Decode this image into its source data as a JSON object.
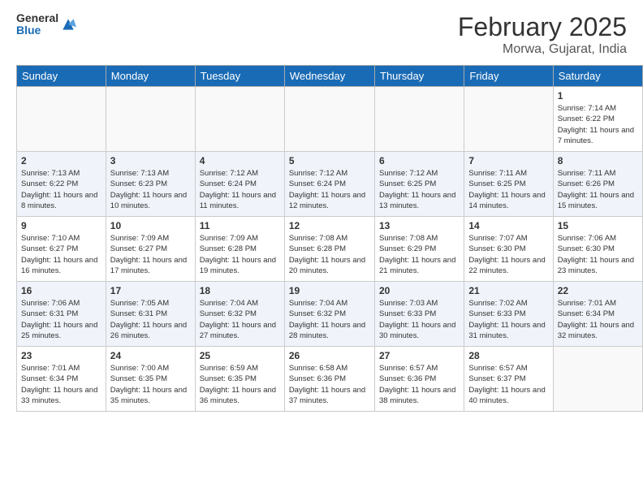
{
  "header": {
    "logo_general": "General",
    "logo_blue": "Blue",
    "month_title": "February 2025",
    "location": "Morwa, Gujarat, India"
  },
  "days_of_week": [
    "Sunday",
    "Monday",
    "Tuesday",
    "Wednesday",
    "Thursday",
    "Friday",
    "Saturday"
  ],
  "weeks": [
    {
      "days": [
        {
          "num": "",
          "info": ""
        },
        {
          "num": "",
          "info": ""
        },
        {
          "num": "",
          "info": ""
        },
        {
          "num": "",
          "info": ""
        },
        {
          "num": "",
          "info": ""
        },
        {
          "num": "",
          "info": ""
        },
        {
          "num": "1",
          "info": "Sunrise: 7:14 AM\nSunset: 6:22 PM\nDaylight: 11 hours and 7 minutes."
        }
      ]
    },
    {
      "days": [
        {
          "num": "2",
          "info": "Sunrise: 7:13 AM\nSunset: 6:22 PM\nDaylight: 11 hours and 8 minutes."
        },
        {
          "num": "3",
          "info": "Sunrise: 7:13 AM\nSunset: 6:23 PM\nDaylight: 11 hours and 10 minutes."
        },
        {
          "num": "4",
          "info": "Sunrise: 7:12 AM\nSunset: 6:24 PM\nDaylight: 11 hours and 11 minutes."
        },
        {
          "num": "5",
          "info": "Sunrise: 7:12 AM\nSunset: 6:24 PM\nDaylight: 11 hours and 12 minutes."
        },
        {
          "num": "6",
          "info": "Sunrise: 7:12 AM\nSunset: 6:25 PM\nDaylight: 11 hours and 13 minutes."
        },
        {
          "num": "7",
          "info": "Sunrise: 7:11 AM\nSunset: 6:25 PM\nDaylight: 11 hours and 14 minutes."
        },
        {
          "num": "8",
          "info": "Sunrise: 7:11 AM\nSunset: 6:26 PM\nDaylight: 11 hours and 15 minutes."
        }
      ]
    },
    {
      "days": [
        {
          "num": "9",
          "info": "Sunrise: 7:10 AM\nSunset: 6:27 PM\nDaylight: 11 hours and 16 minutes."
        },
        {
          "num": "10",
          "info": "Sunrise: 7:09 AM\nSunset: 6:27 PM\nDaylight: 11 hours and 17 minutes."
        },
        {
          "num": "11",
          "info": "Sunrise: 7:09 AM\nSunset: 6:28 PM\nDaylight: 11 hours and 19 minutes."
        },
        {
          "num": "12",
          "info": "Sunrise: 7:08 AM\nSunset: 6:28 PM\nDaylight: 11 hours and 20 minutes."
        },
        {
          "num": "13",
          "info": "Sunrise: 7:08 AM\nSunset: 6:29 PM\nDaylight: 11 hours and 21 minutes."
        },
        {
          "num": "14",
          "info": "Sunrise: 7:07 AM\nSunset: 6:30 PM\nDaylight: 11 hours and 22 minutes."
        },
        {
          "num": "15",
          "info": "Sunrise: 7:06 AM\nSunset: 6:30 PM\nDaylight: 11 hours and 23 minutes."
        }
      ]
    },
    {
      "days": [
        {
          "num": "16",
          "info": "Sunrise: 7:06 AM\nSunset: 6:31 PM\nDaylight: 11 hours and 25 minutes."
        },
        {
          "num": "17",
          "info": "Sunrise: 7:05 AM\nSunset: 6:31 PM\nDaylight: 11 hours and 26 minutes."
        },
        {
          "num": "18",
          "info": "Sunrise: 7:04 AM\nSunset: 6:32 PM\nDaylight: 11 hours and 27 minutes."
        },
        {
          "num": "19",
          "info": "Sunrise: 7:04 AM\nSunset: 6:32 PM\nDaylight: 11 hours and 28 minutes."
        },
        {
          "num": "20",
          "info": "Sunrise: 7:03 AM\nSunset: 6:33 PM\nDaylight: 11 hours and 30 minutes."
        },
        {
          "num": "21",
          "info": "Sunrise: 7:02 AM\nSunset: 6:33 PM\nDaylight: 11 hours and 31 minutes."
        },
        {
          "num": "22",
          "info": "Sunrise: 7:01 AM\nSunset: 6:34 PM\nDaylight: 11 hours and 32 minutes."
        }
      ]
    },
    {
      "days": [
        {
          "num": "23",
          "info": "Sunrise: 7:01 AM\nSunset: 6:34 PM\nDaylight: 11 hours and 33 minutes."
        },
        {
          "num": "24",
          "info": "Sunrise: 7:00 AM\nSunset: 6:35 PM\nDaylight: 11 hours and 35 minutes."
        },
        {
          "num": "25",
          "info": "Sunrise: 6:59 AM\nSunset: 6:35 PM\nDaylight: 11 hours and 36 minutes."
        },
        {
          "num": "26",
          "info": "Sunrise: 6:58 AM\nSunset: 6:36 PM\nDaylight: 11 hours and 37 minutes."
        },
        {
          "num": "27",
          "info": "Sunrise: 6:57 AM\nSunset: 6:36 PM\nDaylight: 11 hours and 38 minutes."
        },
        {
          "num": "28",
          "info": "Sunrise: 6:57 AM\nSunset: 6:37 PM\nDaylight: 11 hours and 40 minutes."
        },
        {
          "num": "",
          "info": ""
        }
      ]
    }
  ]
}
